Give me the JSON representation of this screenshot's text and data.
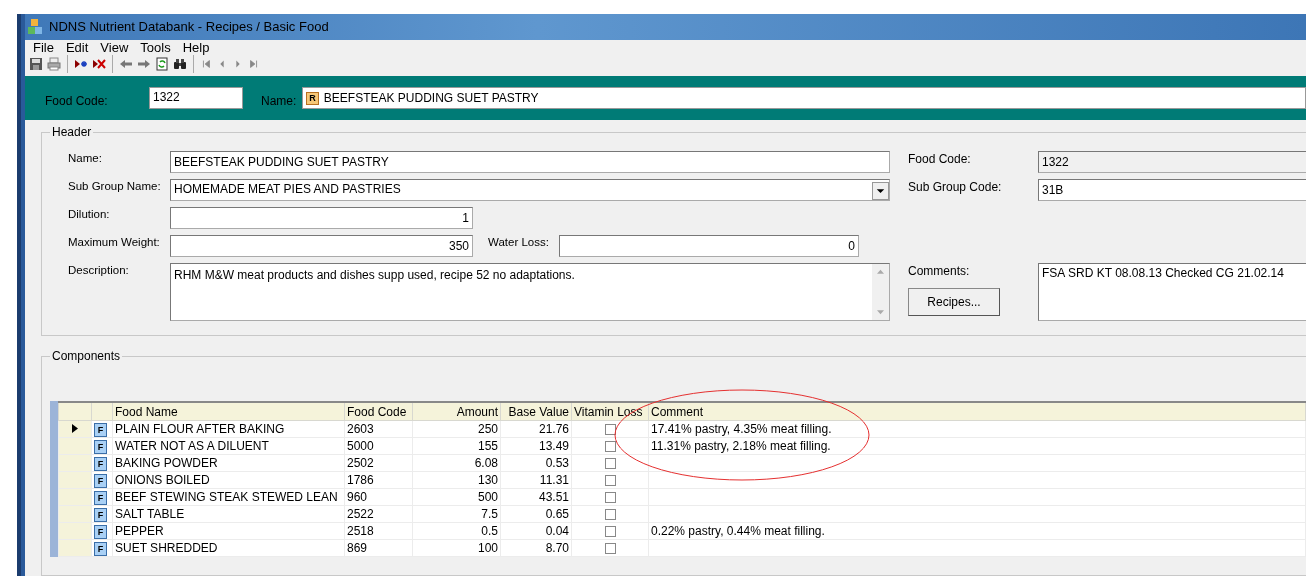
{
  "window": {
    "title": "NDNS Nutrient Databank - Recipes / Basic Food"
  },
  "menu": [
    "File",
    "Edit",
    "View",
    "Tools",
    "Help"
  ],
  "top_bar": {
    "food_code_label": "Food Code:",
    "food_code": "1322",
    "name_label": "Name:",
    "name_badge": "R",
    "name": "BEEFSTEAK PUDDING SUET PASTRY"
  },
  "header": {
    "title": "Header",
    "name": {
      "label": "Name:",
      "value": "BEEFSTEAK PUDDING SUET PASTRY"
    },
    "sub_group_name": {
      "label": "Sub Group Name:",
      "value": "HOMEMADE MEAT PIES AND PASTRIES"
    },
    "dilution": {
      "label": "Dilution:",
      "value": "1"
    },
    "maximum_weight": {
      "label": "Maximum Weight:",
      "value": "350"
    },
    "water_loss": {
      "label": "Water Loss:",
      "value": "0"
    },
    "description": {
      "label": "Description:",
      "value": "RHM M&W meat products and dishes supp used, recipe 52 no adaptations."
    },
    "food_code": {
      "label": "Food Code:",
      "value": "1322"
    },
    "sub_group_code": {
      "label": "Sub Group Code:",
      "value": "31B"
    },
    "comments": {
      "label": "Comments:",
      "value": "FSA SRD KT 08.08.13 Checked CG 21.02.14"
    },
    "recipes_button": "Recipes..."
  },
  "components": {
    "title": "Components",
    "columns": [
      "Food Name",
      "Food Code",
      "Amount",
      "Base Value",
      "Vitamin Loss",
      "Comment"
    ],
    "rows": [
      {
        "selected": true,
        "type": "F",
        "food_name": "PLAIN FLOUR AFTER BAKING",
        "food_code": "2603",
        "amount": "250",
        "base_value": "21.76",
        "vitamin_loss": false,
        "comment": "17.41% pastry, 4.35% meat filling."
      },
      {
        "selected": false,
        "type": "F",
        "food_name": "WATER NOT AS A DILUENT",
        "food_code": "5000",
        "amount": "155",
        "base_value": "13.49",
        "vitamin_loss": false,
        "comment": "11.31% pastry, 2.18% meat filling."
      },
      {
        "selected": false,
        "type": "F",
        "food_name": "BAKING POWDER",
        "food_code": "2502",
        "amount": "6.08",
        "base_value": "0.53",
        "vitamin_loss": false
      },
      {
        "selected": false,
        "type": "F",
        "food_name": "ONIONS BOILED",
        "food_code": "1786",
        "amount": "130",
        "base_value": "11.31",
        "vitamin_loss": false
      },
      {
        "selected": false,
        "type": "F",
        "food_name": "BEEF STEWING STEAK STEWED LEAN",
        "food_code": "960",
        "amount": "500",
        "base_value": "43.51",
        "vitamin_loss": false
      },
      {
        "selected": false,
        "type": "F",
        "food_name": "SALT TABLE",
        "food_code": "2522",
        "amount": "7.5",
        "base_value": "0.65",
        "vitamin_loss": false
      },
      {
        "selected": false,
        "type": "F",
        "food_name": "PEPPER",
        "food_code": "2518",
        "amount": "0.5",
        "base_value": "0.04",
        "vitamin_loss": false,
        "comment": "0.22% pastry, 0.44% meat filling."
      },
      {
        "selected": false,
        "type": "F",
        "food_name": "SUET SHREDDED",
        "food_code": "869",
        "amount": "100",
        "base_value": "8.70",
        "vitamin_loss": false
      }
    ]
  }
}
